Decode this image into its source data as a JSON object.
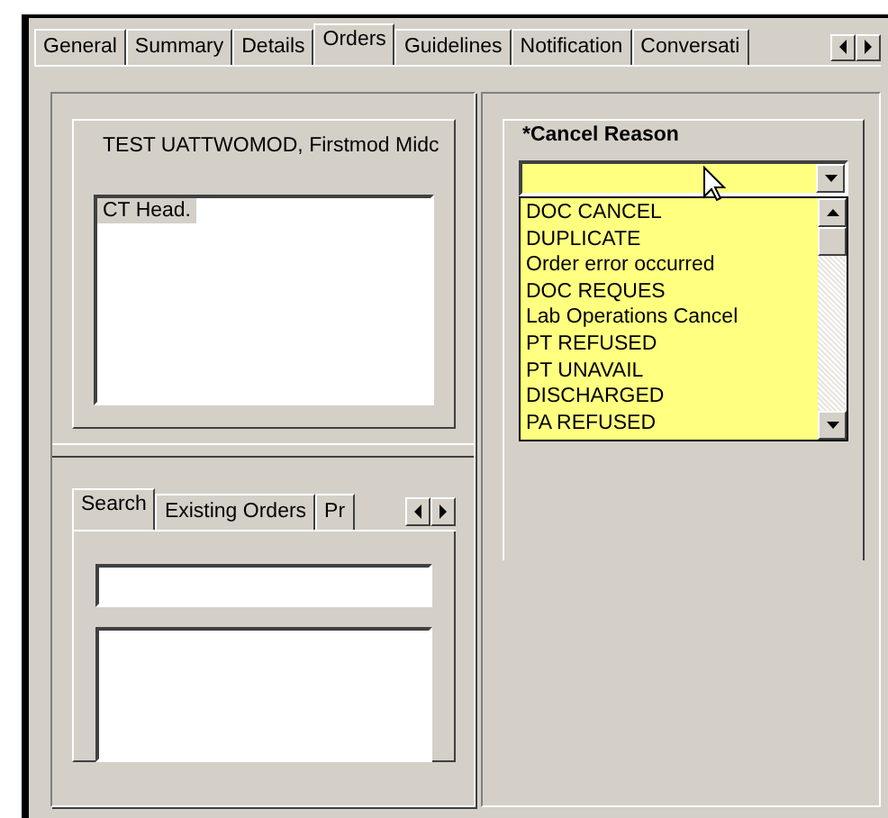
{
  "tabs": [
    {
      "label": "General",
      "selected": false
    },
    {
      "label": "Summary",
      "selected": false
    },
    {
      "label": "Details",
      "selected": false
    },
    {
      "label": "Orders",
      "selected": true
    },
    {
      "label": "Guidelines",
      "selected": false
    },
    {
      "label": "Notification",
      "selected": false
    },
    {
      "label": "Conversati",
      "selected": false
    }
  ],
  "patient_panel": {
    "title": "TEST UATTWOMOD, Firstmod Midc",
    "orders": [
      {
        "label": "CT Head.",
        "selected": true
      }
    ]
  },
  "search_panel": {
    "tabs": [
      {
        "label": "Search",
        "selected": true
      },
      {
        "label": "Existing Orders",
        "selected": false
      },
      {
        "label": "Pr",
        "selected": false
      }
    ]
  },
  "cancel_reason": {
    "label": "*Cancel Reason",
    "options": [
      "DOC CANCEL",
      "DUPLICATE",
      "Order error occurred",
      "DOC REQUES",
      "Lab Operations Cancel",
      "PT REFUSED",
      "PT UNAVAIL",
      "DISCHARGED",
      "PA REFUSED"
    ]
  }
}
